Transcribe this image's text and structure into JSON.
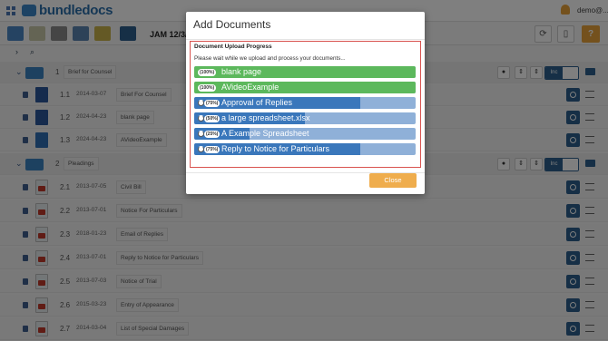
{
  "header": {
    "logo_text": "bundledocs",
    "user": "demo@..."
  },
  "toolbar": {
    "title": "JAM 12/3/"
  },
  "sections": [
    {
      "num": "1",
      "title": "Brief for Counsel",
      "toggle_label": "Inc"
    },
    {
      "num": "2",
      "title": "Pleadings",
      "toggle_label": "Inc"
    }
  ],
  "rows": [
    {
      "num": "1.1",
      "date": "2014-03-07",
      "title": "Brief For Counsel",
      "icon": "word-icon"
    },
    {
      "num": "1.2",
      "date": "2024-04-23",
      "title": "blank page",
      "icon": "word-icon"
    },
    {
      "num": "1.3",
      "date": "2024-04-23",
      "title": "AVideoExample",
      "icon": "video-icon"
    },
    {
      "num": "2.1",
      "date": "2013-07-05",
      "title": "Civil Bill",
      "icon": "pdf-icon"
    },
    {
      "num": "2.2",
      "date": "2013-07-01",
      "title": "Notice For Particulars",
      "icon": "pdf-icon"
    },
    {
      "num": "2.3",
      "date": "2018-01-23",
      "title": "Email of Replies",
      "icon": "pdf-icon"
    },
    {
      "num": "2.4",
      "date": "2013-07-01",
      "title": "Reply to Notice for Particulars",
      "icon": "pdf-icon"
    },
    {
      "num": "2.5",
      "date": "2013-07-03",
      "title": "Notice of Trial",
      "icon": "pdf-icon"
    },
    {
      "num": "2.6",
      "date": "2015-03-23",
      "title": "Entry of Appearance",
      "icon": "pdf-icon"
    },
    {
      "num": "2.7",
      "date": "2014-03-04",
      "title": "List of Special Damages",
      "icon": "pdf-icon"
    }
  ],
  "modal": {
    "title": "Add Documents",
    "heading": "Document Upload Progress",
    "message": "Please wait while we upload and process your documents...",
    "close_label": "Close",
    "uploads": [
      {
        "pct_label": "(100%)",
        "name": "blank page",
        "progress": 1.0,
        "color": "#5cb85c",
        "spinner": false
      },
      {
        "pct_label": "(100%)",
        "name": "AVideoExample",
        "progress": 1.0,
        "color": "#5cb85c",
        "spinner": false
      },
      {
        "pct_label": "(75%)",
        "name": "Approval of Replies",
        "progress": 0.75,
        "color": "#3a77bb",
        "spinner": true
      },
      {
        "pct_label": "(50%)",
        "name": "a large spreadsheet.xlsx",
        "progress": 0.5,
        "color": "#3a77bb",
        "spinner": true
      },
      {
        "pct_label": "(25%)",
        "name": "A Example Spreadsheet",
        "progress": 0.25,
        "color": "#3a77bb",
        "spinner": true
      },
      {
        "pct_label": "(75%)",
        "name": "Reply to Notice for Particulars",
        "progress": 0.75,
        "color": "#3a77bb",
        "spinner": true,
        "prefix": " "
      }
    ]
  }
}
